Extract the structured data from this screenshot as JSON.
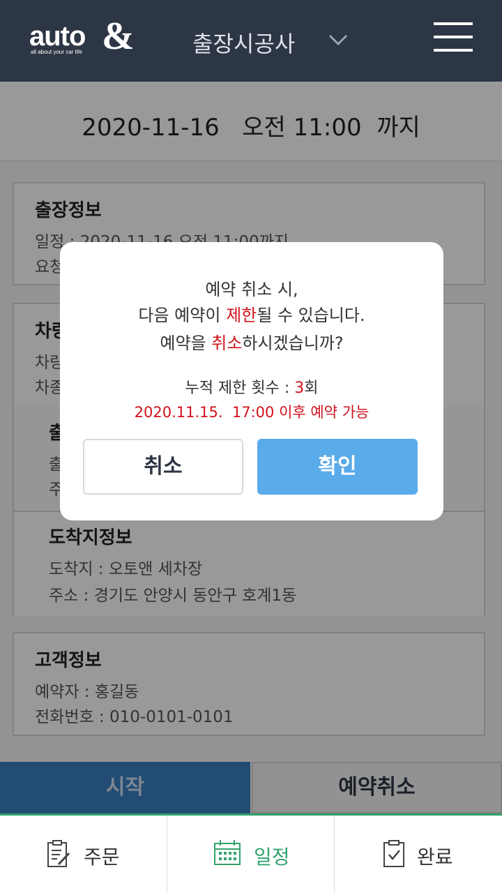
{
  "header": {
    "logo_text": "auto",
    "logo_sub": "all about your car life",
    "logo_amp": "&",
    "title": "출장시공사"
  },
  "deadline": "2020-11-16   오전 11:00  까지",
  "trip_info": {
    "title": "출장정보",
    "schedule": "일정 : 2020-11-16  오전 11:00까지",
    "request": "요청"
  },
  "vehicle_info": {
    "title": "차량",
    "line1": "차량",
    "line2": "차종"
  },
  "departure_info": {
    "title": "출",
    "line1": "출",
    "line2": "주"
  },
  "arrival_info": {
    "title": "도착지정보",
    "place": "도착지 : 오토앤 세차장",
    "address": "주소 : 경기도 안양시 동안구 호계1동"
  },
  "customer_info": {
    "title": "고객정보",
    "name": "예약자 : 홍길동",
    "phone": "전화번호 : 010-0101-0101"
  },
  "actions": {
    "start": "시작",
    "cancel_reservation": "예약취소"
  },
  "tabs": [
    {
      "label": "주문",
      "icon": "order-icon"
    },
    {
      "label": "일정",
      "icon": "calendar-icon",
      "active": true
    },
    {
      "label": "완료",
      "icon": "complete-icon"
    }
  ],
  "dialog": {
    "line1": "예약 취소 시,",
    "line2_a": "다음 예약이 ",
    "line2_red": "제한",
    "line2_b": "될 수 있습니다.",
    "line3_a": "예약을 ",
    "line3_red": "취소",
    "line3_b": "하시겠습니까?",
    "limit_label": "누적 제한 횟수 : ",
    "limit_count": "3",
    "limit_unit": "회",
    "available": "2020.11.15.  17:00 이후 예약 가능",
    "cancel_label": "취소",
    "ok_label": "확인"
  },
  "colors": {
    "header_bg": "#2d3645",
    "accent_blue": "#5aabea",
    "start_blue": "#3a7fc2",
    "warning_red": "#d0121b",
    "tab_active": "#2fa36b"
  }
}
